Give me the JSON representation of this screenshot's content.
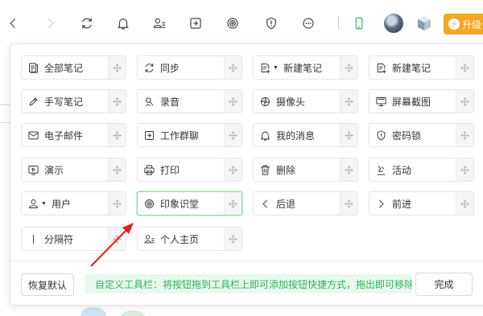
{
  "toolbar": {
    "icons": [
      "back-icon",
      "forward-icon",
      "sync-icon",
      "bell-icon",
      "contacts-icon",
      "share-icon",
      "yinxiang-icon",
      "shield-icon",
      "more-icon",
      "phone-icon"
    ],
    "upgrade_label": "升级"
  },
  "tiles": [
    {
      "label": "全部笔记",
      "icon": "all-notes-icon"
    },
    {
      "label": "同步",
      "icon": "sync-icon"
    },
    {
      "label": "新建笔记",
      "icon": "new-note-icon"
    },
    {
      "label": "新建笔记",
      "icon": "new-note-icon"
    },
    {
      "label": "手写笔记",
      "icon": "pen-icon"
    },
    {
      "label": "录音",
      "icon": "microphone-icon"
    },
    {
      "label": "摄像头",
      "icon": "camera-icon"
    },
    {
      "label": "屏幕截图",
      "icon": "screenshot-icon"
    },
    {
      "label": "电子邮件",
      "icon": "mail-icon"
    },
    {
      "label": "工作群聊",
      "icon": "group-chat-icon"
    },
    {
      "label": "我的消息",
      "icon": "bell-icon"
    },
    {
      "label": "密码锁",
      "icon": "lock-icon"
    },
    {
      "label": "演示",
      "icon": "present-icon"
    },
    {
      "label": "打印",
      "icon": "print-icon"
    },
    {
      "label": "删除",
      "icon": "trash-icon"
    },
    {
      "label": "活动",
      "icon": "activity-icon"
    },
    {
      "label": "用户",
      "icon": "user-icon"
    },
    {
      "label": "印象识堂",
      "icon": "yinxiang-icon"
    },
    {
      "label": "后退",
      "icon": "chevron-left-icon"
    },
    {
      "label": "前进",
      "icon": "chevron-right-icon"
    },
    {
      "label": "分隔符",
      "icon": "separator-icon"
    },
    {
      "label": "个人主页",
      "icon": "profile-icon"
    }
  ],
  "footer": {
    "reset_label": "恢复默认",
    "hint_text": "自定义工具栏：将按钮拖到工具栏上即可添加按钮快捷方式，拖出即可移除。",
    "done_label": "完成"
  },
  "colors": {
    "accent_green": "#2bb35b",
    "upgrade_orange": "#f5a623",
    "annotation_red": "#e02020"
  }
}
